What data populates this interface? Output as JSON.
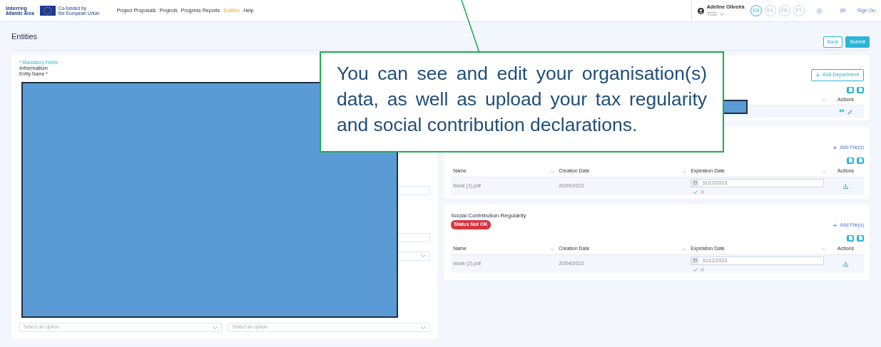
{
  "navbar": {
    "logo": "interreg",
    "logo_sub": "Atlantic Area",
    "eu_line_1": "Co-funded by",
    "eu_line_2": "the European Union",
    "links": [
      {
        "label": "Project Proposals",
        "selected": false
      },
      {
        "label": "Projects",
        "selected": false
      },
      {
        "label": "Progress Reports",
        "selected": false
      },
      {
        "label": "Entities",
        "selected": true
      },
      {
        "label": "Help",
        "selected": false
      }
    ],
    "user": {
      "name": "Adeline Oliveira",
      "org": "TCD"
    },
    "languages": [
      {
        "label": "EN",
        "selected": true
      },
      {
        "label": "ES",
        "selected": false
      },
      {
        "label": "FR",
        "selected": false
      },
      {
        "label": "PT",
        "selected": false
      }
    ],
    "sign_out": "Sign Ou"
  },
  "page": {
    "title": "Entities",
    "buttons": [
      {
        "label": "Back",
        "kind": "outline"
      },
      {
        "label": "Submit",
        "kind": "primary"
      }
    ]
  },
  "form": {
    "mandatory_note": "* Mandatory Fields",
    "section_title": "Information",
    "first_label": "Entity Name *",
    "selects": [
      {
        "placeholder": "Select an option"
      },
      {
        "placeholder": "Select an option"
      }
    ]
  },
  "departments": {
    "add_button": "Add Department",
    "columns": [
      "Actions"
    ]
  },
  "tax_regularity": {
    "add_button": "Add File(s)",
    "columns": [
      "Name",
      "Creation Date",
      "Expiration Date",
      "Actions"
    ],
    "rows": [
      {
        "name": "blank (1).pdf",
        "created": "20/09/2023",
        "expires": "31/12/2023"
      }
    ]
  },
  "social_regularity": {
    "title": "Social Contribution Regularity",
    "badge": "Status Not OK",
    "add_button": "Add File(s)",
    "columns": [
      "Name",
      "Creation Date",
      "Expiration Date",
      "Actions"
    ],
    "rows": [
      {
        "name": "blank (2).pdf",
        "created": "20/04/2023",
        "expires": "31/12/2023"
      }
    ]
  },
  "callout": {
    "text": "You can see and edit your organisation(s) data, as well as upload your tax regularity and social contribution declarations."
  }
}
